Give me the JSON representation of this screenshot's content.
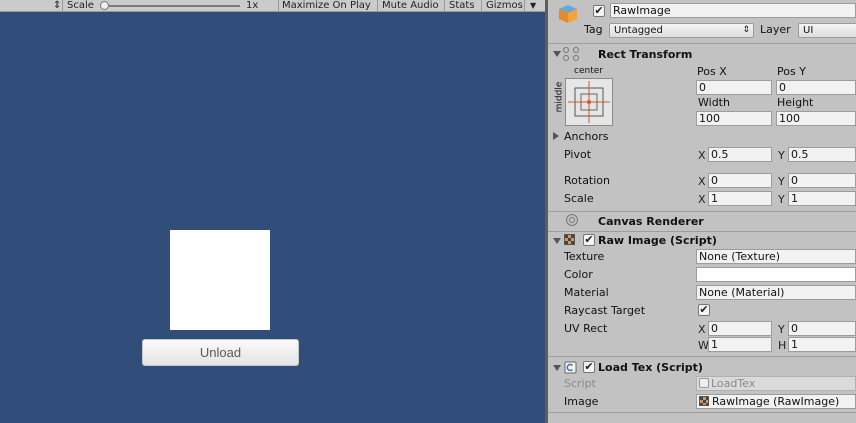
{
  "game_toolbar": {
    "scale_label": "Scale",
    "scale_value": "1x",
    "scale_level": 0,
    "maximize_on_play": "Maximize On Play",
    "mute_audio": "Mute Audio",
    "stats": "Stats",
    "gizmos": "Gizmos"
  },
  "game_view": {
    "unload_button": "Unload"
  },
  "inspector": {
    "object_name": "RawImage",
    "tag_label": "Tag",
    "tag_value": "Untagged",
    "layer_label": "Layer",
    "layer_value": "UI",
    "rect_transform": {
      "title": "Rect Transform",
      "anchor_h": "center",
      "anchor_v": "middle",
      "pos_x_label": "Pos X",
      "pos_y_label": "Pos Y",
      "pos_x": "0",
      "pos_y": "0",
      "width_label": "Width",
      "height_label": "Height",
      "width": "100",
      "height": "100",
      "anchors_label": "Anchors",
      "pivot_label": "Pivot",
      "pivot_x": "0.5",
      "pivot_y": "0.5",
      "rotation_label": "Rotation",
      "rotation_x": "0",
      "rotation_y": "0",
      "scale_label": "Scale",
      "scale_x": "1",
      "scale_y": "1",
      "x": "X",
      "y": "Y"
    },
    "canvas_renderer": {
      "title": "Canvas Renderer"
    },
    "raw_image": {
      "title": "Raw Image (Script)",
      "texture_label": "Texture",
      "texture_value": "None (Texture)",
      "color_label": "Color",
      "color_value": "#ffffff",
      "material_label": "Material",
      "material_value": "None (Material)",
      "raycast_label": "Raycast Target",
      "raycast_checked": true,
      "uv_label": "UV Rect",
      "uv_x": "0",
      "uv_y": "0",
      "uv_w": "1",
      "uv_h": "1",
      "x": "X",
      "y": "Y",
      "w": "W",
      "h": "H"
    },
    "load_tex": {
      "title": "Load Tex (Script)",
      "script_label": "Script",
      "script_value": "LoadTex",
      "image_label": "Image",
      "image_value": "RawImage (RawImage)"
    }
  }
}
